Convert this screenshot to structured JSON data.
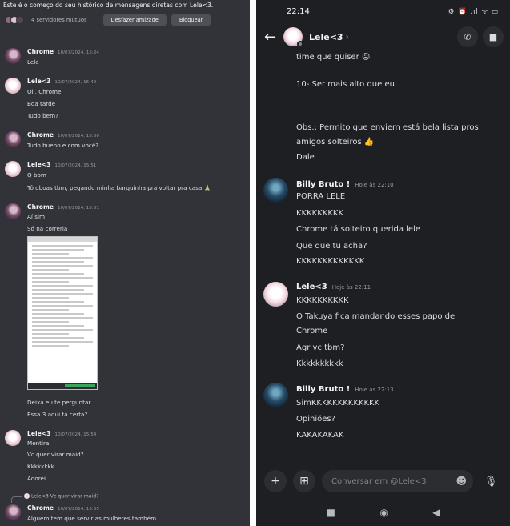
{
  "left": {
    "history_start": "Este é o começo do seu histórico de mensagens diretas com Lele<3.",
    "mutual_servers": "4 servidores mútuos",
    "unfriend_button": "Desfazer amizade",
    "block_button": "Bloquear",
    "messages": [
      {
        "author": "Chrome",
        "time": "10/07/2024, 15:24",
        "lines": [
          "Lele"
        ]
      },
      {
        "author": "Lele<3",
        "time": "10/07/2024, 15:49",
        "lines": [
          "Oii, Chrome",
          "Boa tarde",
          "Tudo bem?"
        ]
      },
      {
        "author": "Chrome",
        "time": "10/07/2024, 15:50",
        "lines": [
          "Tudo bueno e com você?"
        ]
      },
      {
        "author": "Lele<3",
        "time": "10/07/2024, 15:51",
        "lines": [
          "Q bom",
          "Tô dboas tbm, pegando minha barquinha pra voltar pra casa 🙏"
        ]
      },
      {
        "author": "Chrome",
        "time": "10/07/2024, 15:51",
        "lines": [
          "Aí sim",
          "Só na correria"
        ]
      },
      {
        "lines": [
          "Deixa eu te perguntar",
          "Essa 3 aqui tá certa?"
        ]
      },
      {
        "author": "Lele<3",
        "time": "10/07/2024, 15:54",
        "lines": [
          "Mentira",
          "Vc quer virar maid?",
          "Kkkkkkkk",
          "Adorei"
        ]
      },
      {
        "author": "Chrome",
        "time": "10/07/2024, 15:55",
        "reply_to": "Lele<3 Vc quer virar maid?",
        "lines": [
          "Alguém tem que servir as mulheres também"
        ]
      }
    ]
  },
  "right": {
    "status_time": "22:14",
    "status_icons": "⚙ ⏰ .ıl ᯤ ▭",
    "contact_name": "Lele<3",
    "input_placeholder": "Conversar em @Lele<3",
    "continued_lines": [
      "time que quiser 😛",
      "10- Ser mais alto que eu.",
      "Obs.: Permito que enviem está bela lista pros",
      "amigos solteiros 👍",
      "Dale"
    ],
    "messages": [
      {
        "author": "Billy Bruto !",
        "time": "Hoje às 22:10",
        "lines": [
          "PORRA LELE",
          "KKKKKKKKK",
          "Chrome tá solteiro querida lele",
          "Que que tu acha?",
          "KKKKKKKKKKKKK"
        ]
      },
      {
        "author": "Lele<3",
        "time": "Hoje às 22:11",
        "lines": [
          "KKKKKKKKKK",
          "O Takuya fica mandando esses papo de",
          "Chrome",
          "Agr vc tbm?",
          "Kkkkkkkkkk"
        ]
      },
      {
        "author": "Billy Bruto !",
        "time": "Hoje às 22:13",
        "lines": [
          "SimKKKKKKKKKKKKK",
          "Opiniões?",
          "KAKAKAKAK"
        ]
      }
    ]
  },
  "colors": {
    "left_bg": "#313338",
    "right_bg": "#1e1f22",
    "text": "#dbdee1",
    "muted": "#949ba4"
  }
}
